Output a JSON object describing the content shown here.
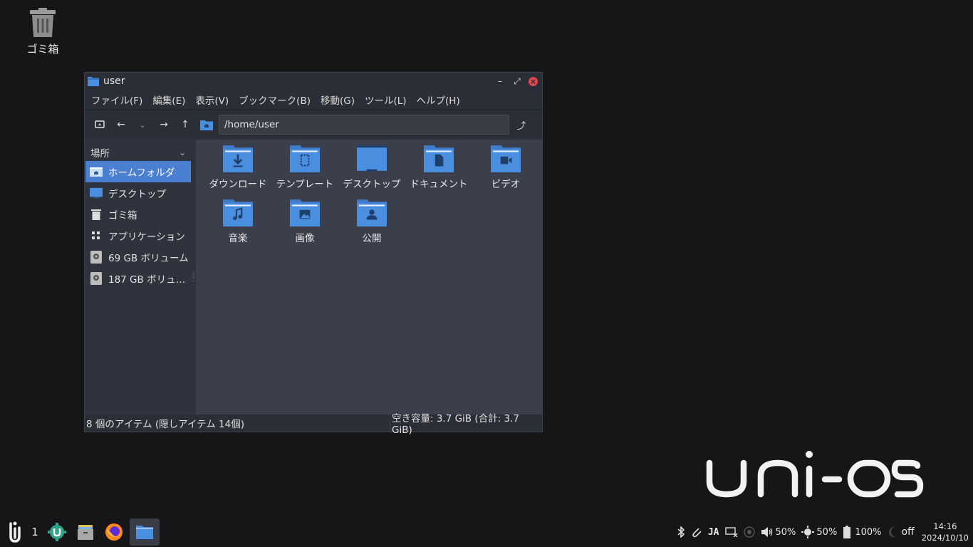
{
  "desktop": {
    "trash_label": "ゴミ箱"
  },
  "window": {
    "title": "user",
    "menu": [
      "ファイル(F)",
      "編集(E)",
      "表示(V)",
      "ブックマーク(B)",
      "移動(G)",
      "ツール(L)",
      "ヘルプ(H)"
    ],
    "path": "/home/user"
  },
  "sidebar": {
    "heading": "場所",
    "items": [
      {
        "label": "ホームフォルダ",
        "icon": "home-folder-icon"
      },
      {
        "label": "デスクトップ",
        "icon": "desktop-icon"
      },
      {
        "label": "ゴミ箱",
        "icon": "trash-icon"
      },
      {
        "label": "アプリケーション",
        "icon": "apps-icon"
      },
      {
        "label": "69 GB ボリューム",
        "icon": "drive-icon"
      },
      {
        "label": "187 GB ボリュ…",
        "icon": "drive-icon"
      }
    ]
  },
  "files": [
    {
      "label": "ダウンロード",
      "icon": "download"
    },
    {
      "label": "テンプレート",
      "icon": "template"
    },
    {
      "label": "デスクトップ",
      "icon": "desktop"
    },
    {
      "label": "ドキュメント",
      "icon": "document"
    },
    {
      "label": "ビデオ",
      "icon": "video"
    },
    {
      "label": "音楽",
      "icon": "music"
    },
    {
      "label": "画像",
      "icon": "image"
    },
    {
      "label": "公開",
      "icon": "public"
    }
  ],
  "status": {
    "items": "8 個のアイテム (隠しアイテム 14個)",
    "free": "空き容量: 3.7 GiB (合計: 3.7 GiB)"
  },
  "logo_text": "uni-os",
  "taskbar": {
    "workspace": "1",
    "tray": {
      "input_method": "JA",
      "volume": "50%",
      "brightness": "50%",
      "battery": "100%",
      "night_mode": "off",
      "time": "14:16",
      "date": "2024/10/10"
    }
  },
  "colors": {
    "accent": "#4a7fd1",
    "folder": "#4a8ee0",
    "close": "#e0484e"
  }
}
